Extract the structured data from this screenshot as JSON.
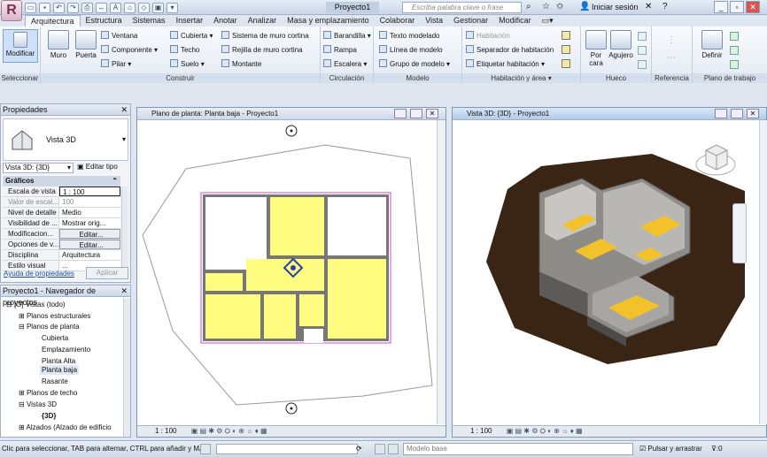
{
  "app": {
    "doc_title": "Proyecto1",
    "search_placeholder": "Escriba palabra clave o frase",
    "sign_in": "Iniciar sesión",
    "app_icon": "R"
  },
  "tabs": [
    "Arquitectura",
    "Estructura",
    "Sistemas",
    "Insertar",
    "Anotar",
    "Analizar",
    "Masa y emplazamiento",
    "Colaborar",
    "Vista",
    "Gestionar",
    "Modificar"
  ],
  "ribbon": {
    "panels": {
      "seleccionar": "Seleccionar",
      "construir": "Construir",
      "circulacion": "Circulación",
      "modelo": "Modelo",
      "habitacion": "Habitación y área ▾",
      "hueco": "Hueco",
      "referencia": "Referencia",
      "plano_trabajo": "Plano de trabajo"
    },
    "modificar": "Modificar",
    "muro": "Muro",
    "puerta": "Puerta",
    "ventana": "Ventana",
    "componente": "Componente",
    "pilar": "Pilar",
    "cubierta": "Cubierta",
    "techo": "Techo",
    "suelo": "Suelo",
    "sistema_muro_cortina": "Sistema de muro cortina",
    "rejilla_muro_cortina": "Rejilla de muro cortina",
    "montante": "Montante",
    "barandilla": "Barandilla",
    "rampa": "Rampa",
    "escalera": "Escalera",
    "texto_modelado": "Texto modelado",
    "linea_modelo": "Línea de modelo",
    "grupo_modelo": "Grupo de modelo",
    "habitacion": "Habitación",
    "separador_habitacion": "Separador de habitación",
    "etiquetar_habitacion": "Etiquetar habitación",
    "por_cara": "Por cara",
    "agujero": "Agujero",
    "definir": "Definir"
  },
  "properties": {
    "title": "Propiedades",
    "type_name": "Vista 3D",
    "selector_value": "Vista 3D: {3D}",
    "edit_type": "Editar tipo",
    "group_label": "Gráficos",
    "rows": [
      {
        "k": "Escala de vista",
        "v": "1 : 100"
      },
      {
        "k": "Valor de escal...",
        "v": "100"
      },
      {
        "k": "Nivel de detalle",
        "v": "Medio"
      },
      {
        "k": "Visibilidad de ...",
        "v": "Mostrar orig..."
      },
      {
        "k": "Modificacion...",
        "v": "Editar..."
      },
      {
        "k": "Opciones de v...",
        "v": "Editar..."
      },
      {
        "k": "Disciplina",
        "v": "Arquitectura"
      },
      {
        "k": "Estilo visual",
        "v": "..."
      }
    ],
    "help_link": "Ayuda de propiedades",
    "apply": "Aplicar"
  },
  "browser": {
    "title": "Proyecto1 - Navegador de proyectos",
    "items": [
      {
        "label": "[O] Vistas (todo)",
        "lvl": 0
      },
      {
        "label": "Planos estructurales",
        "lvl": 1
      },
      {
        "label": "Planos de planta",
        "lvl": 1
      },
      {
        "label": "Cubierta",
        "lvl": 2
      },
      {
        "label": "Emplazamiento",
        "lvl": 2
      },
      {
        "label": "Planta Alta",
        "lvl": 2
      },
      {
        "label": "Planta baja",
        "lvl": 2
      },
      {
        "label": "Rasante",
        "lvl": 2
      },
      {
        "label": "Planos de techo",
        "lvl": 1
      },
      {
        "label": "Vistas 3D",
        "lvl": 1
      },
      {
        "label": "{3D}",
        "lvl": 2
      },
      {
        "label": "Alzados (Alzado de edificio",
        "lvl": 1
      }
    ]
  },
  "plan_view": {
    "title": "Plano de planta: Planta baja - Proyecto1",
    "scale": "1 : 100"
  },
  "view3d": {
    "title": "Vista 3D: {3D} - Proyecto1",
    "scale": "1 : 100"
  },
  "status": {
    "hint": "Clic para seleccionar, TAB para alternar, CTRL para añadir y MA",
    "base_model": "Modelo base",
    "press_drag": "Pulsar y arrastrar",
    "filter_count": ":0"
  },
  "colors": {
    "room_fill": "#fdfc7f",
    "wall": "#6a6a6a",
    "terrain": "#3a2414",
    "floor3d": "#f3c22a"
  }
}
